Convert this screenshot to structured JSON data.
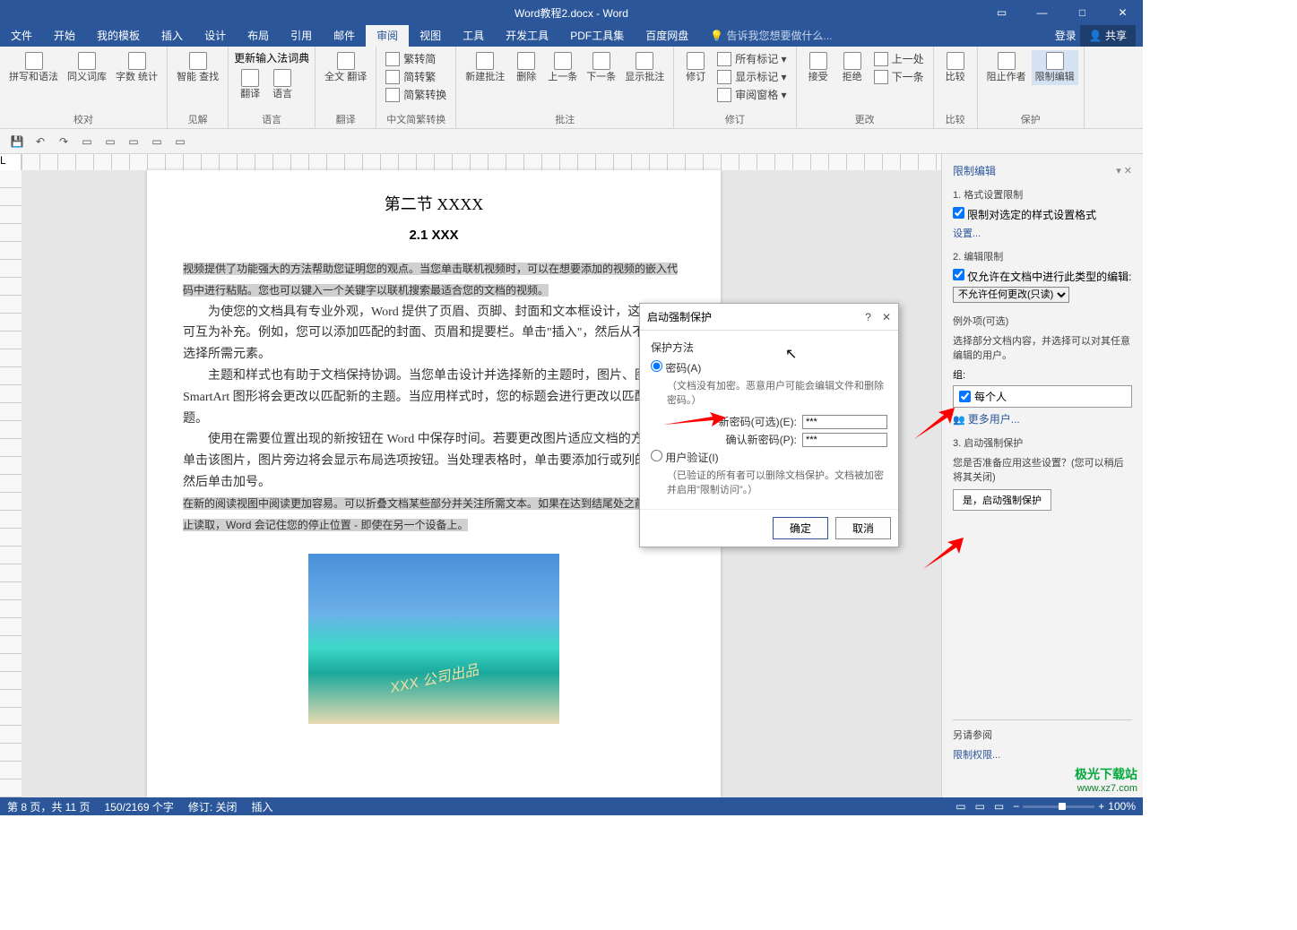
{
  "title": "Word教程2.docx - Word",
  "winbtns": {
    "ribbon": "▭",
    "min": "—",
    "max": "□",
    "close": "✕"
  },
  "tabs": [
    "文件",
    "开始",
    "我的模板",
    "插入",
    "设计",
    "布局",
    "引用",
    "邮件",
    "审阅",
    "视图",
    "工具",
    "开发工具",
    "PDF工具集",
    "百度网盘"
  ],
  "active_tab": 8,
  "tellme": "告诉我您想要做什么...",
  "right_btns": {
    "login": "登录",
    "share": "共享"
  },
  "ribbon": {
    "g1": {
      "label": "校对",
      "items": [
        {
          "l": "拼写和语法"
        },
        {
          "l": "同义词库"
        },
        {
          "l": "字数\n统计"
        }
      ]
    },
    "g2": {
      "label": "见解",
      "items": [
        {
          "l": "智能\n查找"
        }
      ]
    },
    "g3": {
      "label": "语言",
      "items": [
        {
          "l": "翻译"
        },
        {
          "l": "语言"
        }
      ],
      "update": "更新输入法词典"
    },
    "g4": {
      "label": "翻译",
      "items": [
        {
          "l": "全文\n翻译"
        }
      ]
    },
    "g5": {
      "label": "中文简繁转换",
      "rows": [
        "繁转简",
        "简转繁",
        "简繁转换"
      ]
    },
    "g6": {
      "label": "批注",
      "items": [
        {
          "l": "新建批注"
        },
        {
          "l": "删除"
        },
        {
          "l": "上一条"
        },
        {
          "l": "下一条"
        },
        {
          "l": "显示批注"
        }
      ]
    },
    "g7": {
      "label": "修订",
      "items": [
        {
          "l": "修订"
        }
      ],
      "rows": [
        "所有标记 ▾",
        "显示标记 ▾",
        "审阅窗格 ▾"
      ]
    },
    "g8": {
      "label": "更改",
      "items": [
        {
          "l": "接受"
        },
        {
          "l": "拒绝"
        }
      ],
      "rows": [
        "上一处",
        "下一条"
      ]
    },
    "g9": {
      "label": "比较",
      "items": [
        {
          "l": "比较"
        }
      ]
    },
    "g10": {
      "label": "保护",
      "items": [
        {
          "l": "阻止作者"
        },
        {
          "l": "限制编辑"
        }
      ]
    }
  },
  "doc": {
    "h2": "第二节  XXXX",
    "h3": "2.1 XXX",
    "p1": "视频提供了功能强大的方法帮助您证明您的观点。当您单击联机视频时，可以在想要添加的视频的嵌入代码中进行粘贴。您也可以键入一个关键字以联机搜索最适合您的文档的视频。",
    "p2": "为使您的文档具有专业外观，Word 提供了页眉、页脚、封面和文本框设计，这些设计可互为补充。例如，您可以添加匹配的封面、页眉和提要栏。单击\"插入\"，然后从不同库中选择所需元素。",
    "p3": "主题和样式也有助于文档保持协调。当您单击设计并选择新的主题时，图片、图表或 SmartArt 图形将会更改以匹配新的主题。当应用样式时，您的标题会进行更改以匹配新的主题。",
    "p4": "使用在需要位置出现的新按钮在 Word 中保存时间。若要更改图片适应文档的方式，请单击该图片，图片旁边将会显示布局选项按钮。当处理表格时，单击要添加行或列的位置，然后单击加号。",
    "p5a": "在新的阅读视图中阅读更加容易。可以折叠文档某些部分并关注所需文本。如果在达到结尾处之前需要停止读取，Word 会记住您的停止位置 - 即使在另一个设备上。",
    "wm": "XXX 公司出品"
  },
  "dialog": {
    "title": "启动强制保护",
    "help": "?",
    "close": "✕",
    "section": "保护方法",
    "opt1": "密码(A)",
    "opt1_note": "（文档没有加密。恶意用户可能会编辑文件和删除密码。）",
    "pw1": "新密码(可选)(E):",
    "pw2": "确认新密码(P):",
    "pwval": "***",
    "opt2": "用户验证(I)",
    "opt2_note": "（已验证的所有者可以删除文档保护。文档被加密并启用\"限制访问\"。）",
    "ok": "确定",
    "cancel": "取消"
  },
  "panel": {
    "title": "限制编辑",
    "close": "▾ ✕",
    "s1": "1. 格式设置限制",
    "s1c": "限制对选定的样式设置格式",
    "s1l": "设置...",
    "s2": "2. 编辑限制",
    "s2c": "仅允许在文档中进行此类型的编辑:",
    "s2s": "不允许任何更改(只读)",
    "s2ex": "例外项(可选)",
    "s2ex_note": "选择部分文档内容，并选择可以对其任意编辑的用户。",
    "grp_label": "组:",
    "grp_item": "每个人",
    "more": "更多用户...",
    "s3": "3. 启动强制保护",
    "s3_note": "您是否准备应用这些设置？(您可以稍后将其关闭)",
    "s3_btn": "是，启动强制保护",
    "see": "另请参阅",
    "perm": "限制权限..."
  },
  "status": {
    "page": "第 8 页，共 11 页",
    "words": "150/2169 个字",
    "track": "修订: 关闭",
    "ins": "插入",
    "zoom": "100%"
  },
  "watermark": {
    "l1": "极光下载站",
    "l2": "www.xz7.com"
  }
}
